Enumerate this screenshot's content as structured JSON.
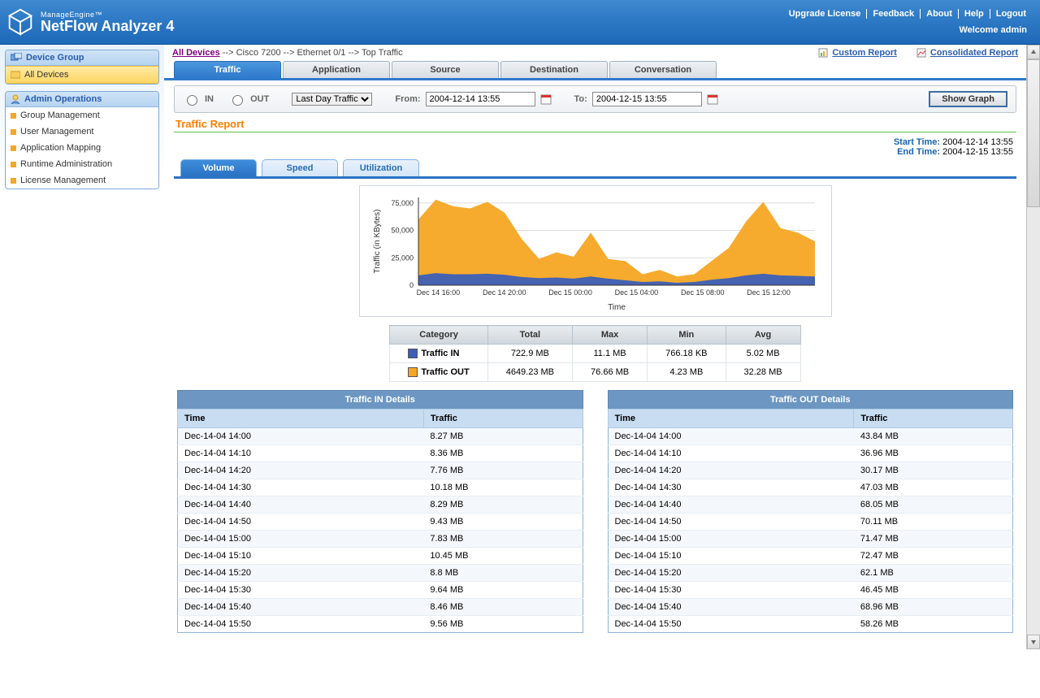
{
  "header": {
    "brand_small": "ManageEngine™",
    "brand_main": "NetFlow Analyzer 4",
    "links": [
      "Upgrade License",
      "Feedback",
      "About",
      "Help",
      "Logout"
    ],
    "welcome": "Welcome admin"
  },
  "sidebar": {
    "device_group": {
      "title": "Device Group",
      "all_devices": "All Devices"
    },
    "admin_ops": {
      "title": "Admin Operations",
      "items": [
        "Group Management",
        "User Management",
        "Application Mapping",
        "Runtime Administration",
        "License Management"
      ]
    }
  },
  "breadcrumb": {
    "root": "All Devices",
    "trail": " --> Cisco 7200 --> Ethernet 0/1 --> Top Traffic"
  },
  "report_links": {
    "custom": "Custom Report",
    "consolidated": "Consolidated Report"
  },
  "main_tabs": [
    "Traffic",
    "Application",
    "Source",
    "Destination",
    "Conversation"
  ],
  "options": {
    "in": "IN",
    "out": "OUT",
    "range_sel": "Last Day Traffic",
    "from_lbl": "From:",
    "from_val": "2004-12-14 13:55",
    "to_lbl": "To:",
    "to_val": "2004-12-15 13:55",
    "show_btn": "Show Graph"
  },
  "report_title": "Traffic Report",
  "times": {
    "start_lbl": "Start Time:",
    "start_val": "2004-12-14 13:55",
    "end_lbl": "End Time:",
    "end_val": "2004-12-15 13:55"
  },
  "sub_tabs": [
    "Volume",
    "Speed",
    "Utilization"
  ],
  "chart_data": {
    "type": "area",
    "title": "",
    "xlabel": "Time",
    "ylabel": "Traffic (in KBytes)",
    "ylim": [
      0,
      80000
    ],
    "yticks": [
      0,
      25000,
      50000,
      75000
    ],
    "xticks": [
      "Dec 14 16:00",
      "Dec 14 20:00",
      "Dec 15 00:00",
      "Dec 15 04:00",
      "Dec 15 08:00",
      "Dec 15 12:00"
    ],
    "x": [
      0,
      1,
      2,
      3,
      4,
      5,
      6,
      7,
      8,
      9,
      10,
      11,
      12,
      13,
      14,
      15,
      16,
      17,
      18,
      19,
      20,
      21,
      22,
      23
    ],
    "series": [
      {
        "name": "Traffic OUT",
        "color": "#f5a623",
        "values": [
          60000,
          78000,
          72000,
          70000,
          76000,
          66000,
          42000,
          24000,
          30000,
          26000,
          48000,
          24000,
          22000,
          10000,
          14000,
          8000,
          10000,
          22000,
          34000,
          58000,
          76000,
          52000,
          48000,
          40000
        ]
      },
      {
        "name": "Traffic IN",
        "color": "#3b5fb8",
        "values": [
          9000,
          11000,
          10000,
          10000,
          10500,
          9500,
          7500,
          6500,
          7000,
          6000,
          8000,
          6000,
          4500,
          3000,
          3500,
          2200,
          3000,
          5000,
          6500,
          9000,
          10500,
          9000,
          8500,
          8000
        ]
      }
    ]
  },
  "summary": {
    "headers": [
      "Category",
      "Total",
      "Max",
      "Min",
      "Avg"
    ],
    "rows": [
      {
        "color": "#3b5fb8",
        "cat": "Traffic IN",
        "total": "722.9 MB",
        "max": "11.1 MB",
        "min": "766.18 KB",
        "avg": "5.02 MB"
      },
      {
        "color": "#f5a623",
        "cat": "Traffic OUT",
        "total": "4649.23 MB",
        "max": "76.66 MB",
        "min": "4.23 MB",
        "avg": "32.28 MB"
      }
    ]
  },
  "details": {
    "in": {
      "title": "Traffic IN Details",
      "cols": [
        "Time",
        "Traffic"
      ],
      "rows": [
        [
          "Dec-14-04 14:00",
          "8.27 MB"
        ],
        [
          "Dec-14-04 14:10",
          "8.36 MB"
        ],
        [
          "Dec-14-04 14:20",
          "7.76 MB"
        ],
        [
          "Dec-14-04 14:30",
          "10.18 MB"
        ],
        [
          "Dec-14-04 14:40",
          "8.29 MB"
        ],
        [
          "Dec-14-04 14:50",
          "9.43 MB"
        ],
        [
          "Dec-14-04 15:00",
          "7.83 MB"
        ],
        [
          "Dec-14-04 15:10",
          "10.45 MB"
        ],
        [
          "Dec-14-04 15:20",
          "8.8 MB"
        ],
        [
          "Dec-14-04 15:30",
          "9.64 MB"
        ],
        [
          "Dec-14-04 15:40",
          "8.46 MB"
        ],
        [
          "Dec-14-04 15:50",
          "9.56 MB"
        ]
      ]
    },
    "out": {
      "title": "Traffic OUT Details",
      "cols": [
        "Time",
        "Traffic"
      ],
      "rows": [
        [
          "Dec-14-04 14:00",
          "43.84 MB"
        ],
        [
          "Dec-14-04 14:10",
          "36.96 MB"
        ],
        [
          "Dec-14-04 14:20",
          "30.17 MB"
        ],
        [
          "Dec-14-04 14:30",
          "47.03 MB"
        ],
        [
          "Dec-14-04 14:40",
          "68.05 MB"
        ],
        [
          "Dec-14-04 14:50",
          "70.11 MB"
        ],
        [
          "Dec-14-04 15:00",
          "71.47 MB"
        ],
        [
          "Dec-14-04 15:10",
          "72.47 MB"
        ],
        [
          "Dec-14-04 15:20",
          "62.1 MB"
        ],
        [
          "Dec-14-04 15:30",
          "46.45 MB"
        ],
        [
          "Dec-14-04 15:40",
          "68.96 MB"
        ],
        [
          "Dec-14-04 15:50",
          "58.26 MB"
        ]
      ]
    }
  }
}
